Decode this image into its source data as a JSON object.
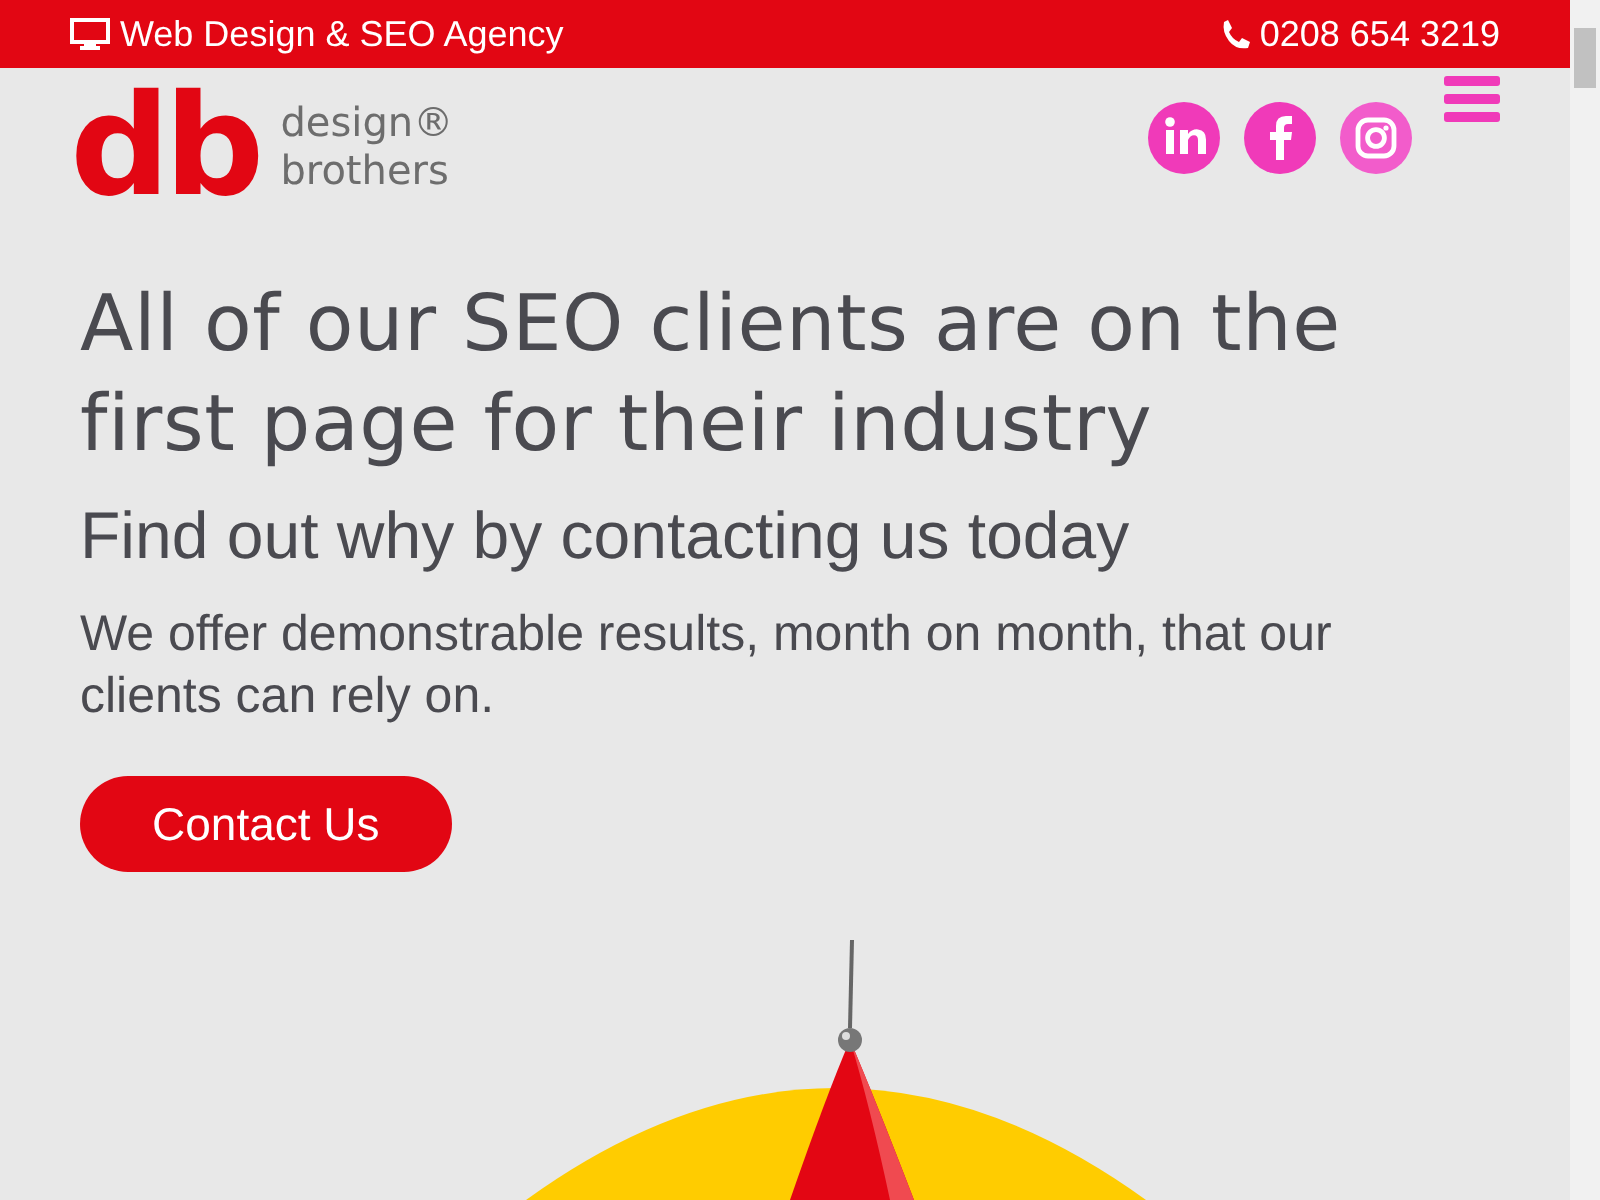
{
  "top_bar": {
    "tagline": "Web Design & SEO Agency",
    "phone": "0208 654 3219"
  },
  "logo": {
    "mark": "db",
    "line_1": "design®",
    "line_2": "brothers"
  },
  "social_links": [
    {
      "kind": "linkedin"
    },
    {
      "kind": "facebook"
    },
    {
      "kind": "instagram"
    }
  ],
  "hero": {
    "heading": "All of our SEO clients are on the first page for their industry",
    "subheading": "Find out why by contacting us today",
    "body": "We offer demonstrable results, month on month, that our clients can rely on.",
    "button": "Contact Us"
  }
}
